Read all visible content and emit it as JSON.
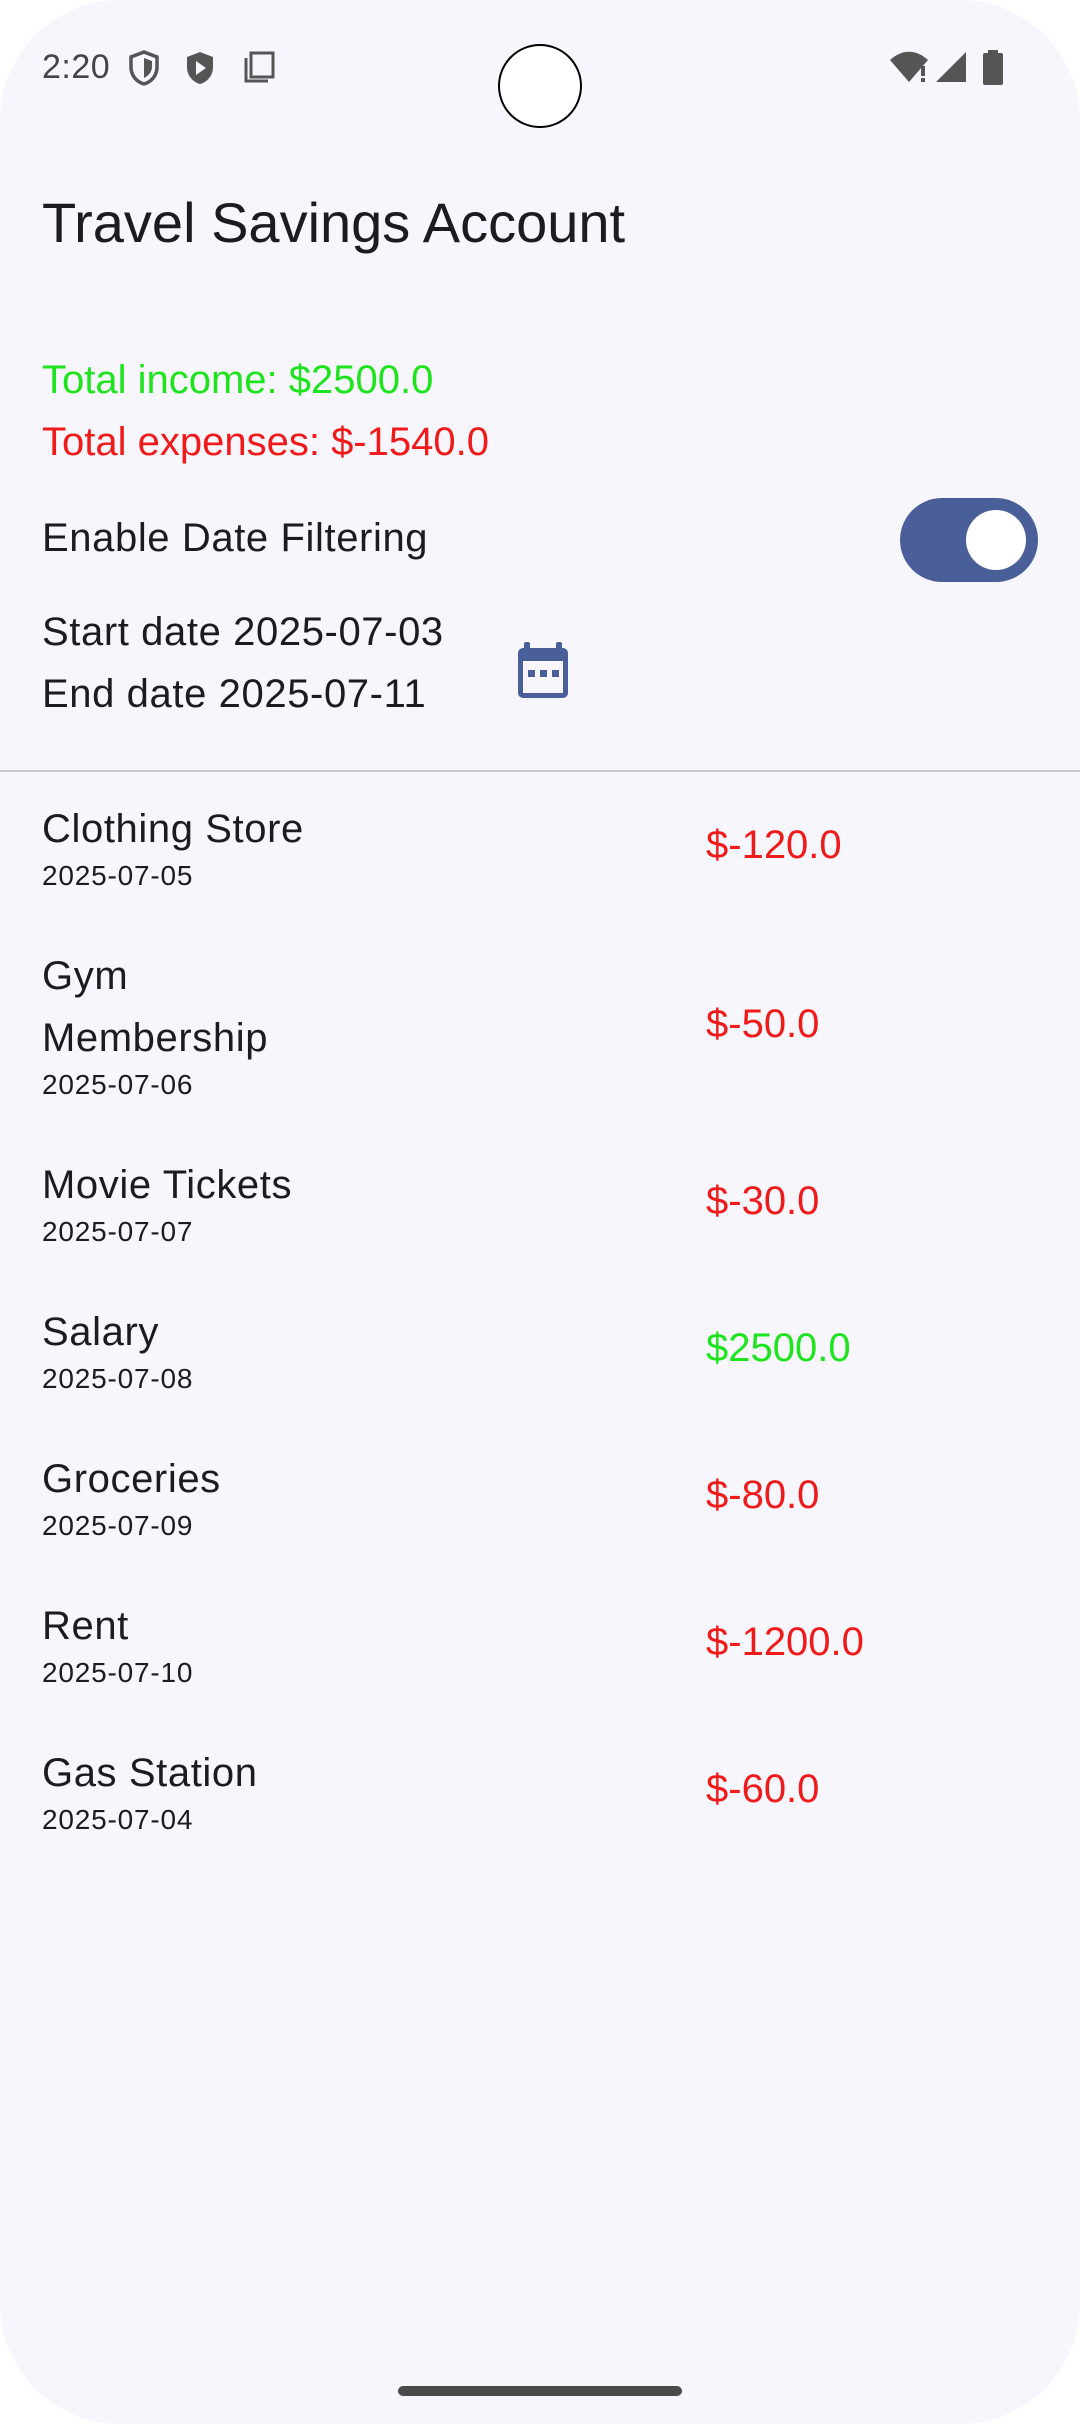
{
  "status_bar": {
    "time": "2:20",
    "left_icons": [
      "shield-outline-icon",
      "shield-play-icon",
      "copy-icon"
    ],
    "right_icons": [
      "wifi-icon",
      "signal-icon",
      "battery-icon"
    ]
  },
  "header": {
    "title": "Travel Savings Account"
  },
  "summary": {
    "income_label": "Total income: ",
    "income_value": "$2500.0",
    "expenses_label": "Total expenses: ",
    "expenses_value": "$-1540.0",
    "income_color": "#1ee41e",
    "expense_color": "#ef1b1b"
  },
  "filter": {
    "label": "Enable Date Filtering",
    "enabled": true,
    "toggle_color": "#4a5f9a",
    "start_label": "Start date ",
    "start_date": "2025-07-03",
    "end_label": "End date ",
    "end_date": "2025-07-11",
    "calendar_icon": "calendar-icon"
  },
  "transactions": [
    {
      "name": "Clothing Store",
      "date": "2025-07-05",
      "amount": "$-120.0"
    },
    {
      "name": "Gym Membership",
      "date": "2025-07-06",
      "amount": "$-50.0"
    },
    {
      "name": "Movie Tickets",
      "date": "2025-07-07",
      "amount": "$-30.0"
    },
    {
      "name": "Salary",
      "date": "2025-07-08",
      "amount": "$2500.0"
    },
    {
      "name": "Groceries",
      "date": "2025-07-09",
      "amount": "$-80.0"
    },
    {
      "name": "Rent",
      "date": "2025-07-10",
      "amount": "$-1200.0"
    },
    {
      "name": "Gas Station",
      "date": "2025-07-04",
      "amount": "$-60.0"
    }
  ]
}
